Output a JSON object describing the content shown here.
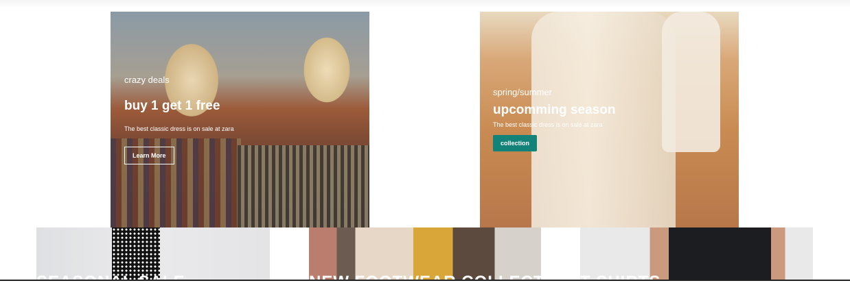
{
  "banners": [
    {
      "eyebrow": "crazy deals",
      "headline": "buy 1 get 1 free",
      "subtitle": "The best classic dress is on sale at zara",
      "button": "Learn More"
    },
    {
      "eyebrow": "spring/summer",
      "headline": "upcomming season",
      "subtitle": "The best classic dress is on sale at zara",
      "button": "collection",
      "button_color": "#138278"
    }
  ],
  "cards": [
    {
      "title": "SEASONAL SALE"
    },
    {
      "title": "NEW FOOTWEAR COLLECTION"
    },
    {
      "title": "T-SHIRTS"
    }
  ]
}
